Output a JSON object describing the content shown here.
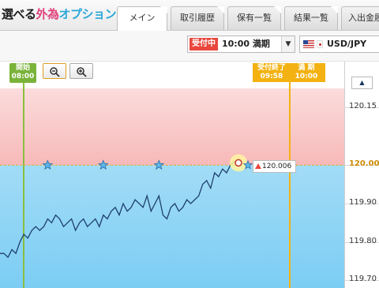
{
  "logo": {
    "part1": "選べる",
    "part2": "外為",
    "part3": "オプション"
  },
  "tabs": [
    {
      "label": "メイン"
    },
    {
      "label": "取引履歴"
    },
    {
      "label": "保有一覧"
    },
    {
      "label": "結果一覧"
    },
    {
      "label": "入出金履"
    }
  ],
  "expiry": {
    "status": "受付中",
    "time": "10:00 満期"
  },
  "pair": {
    "name": "USD/JPY"
  },
  "markers": {
    "open_label": "開始",
    "open_time": "08:00",
    "close_accept_label": "受付終了",
    "close_accept_time": "09:58",
    "expiry_label": "満 期",
    "expiry_time": "10:00"
  },
  "current_price": "120.006",
  "axis": {
    "ticks": [
      "120.15",
      "120.00",
      "119.90",
      "119.80",
      "119.70"
    ],
    "strike": "120.00"
  },
  "chart_data": {
    "type": "line",
    "series": [
      {
        "x": [
          0,
          1,
          2,
          3,
          4,
          5,
          6,
          7,
          8,
          9,
          10,
          11,
          12,
          13,
          14,
          15,
          16,
          17,
          18,
          19,
          20,
          21,
          22,
          23,
          24,
          25,
          26,
          27,
          28,
          29,
          30,
          31,
          32,
          33,
          34,
          35,
          36,
          37,
          38,
          39,
          40,
          41,
          42,
          43,
          44,
          45,
          46,
          47,
          48,
          49,
          50,
          51,
          52,
          53,
          54,
          55,
          56,
          57,
          58,
          59,
          60
        ],
        "values": [
          119.77,
          119.77,
          119.76,
          119.78,
          119.77,
          119.8,
          119.82,
          119.81,
          119.83,
          119.84,
          119.83,
          119.84,
          119.86,
          119.85,
          119.87,
          119.86,
          119.84,
          119.85,
          119.86,
          119.83,
          119.85,
          119.86,
          119.84,
          119.85,
          119.86,
          119.84,
          119.87,
          119.86,
          119.88,
          119.89,
          119.87,
          119.9,
          119.88,
          119.89,
          119.91,
          119.9,
          119.89,
          119.92,
          119.88,
          119.9,
          119.92,
          119.87,
          119.86,
          119.89,
          119.9,
          119.88,
          119.89,
          119.91,
          119.9,
          119.91,
          119.92,
          119.95,
          119.96,
          119.94,
          119.98,
          119.97,
          119.99,
          119.98,
          120.0,
          120.01,
          120.006
        ]
      }
    ],
    "ylim": [
      119.68,
      120.2
    ],
    "strike": 120.0,
    "stars": [
      10,
      24,
      38
    ]
  }
}
